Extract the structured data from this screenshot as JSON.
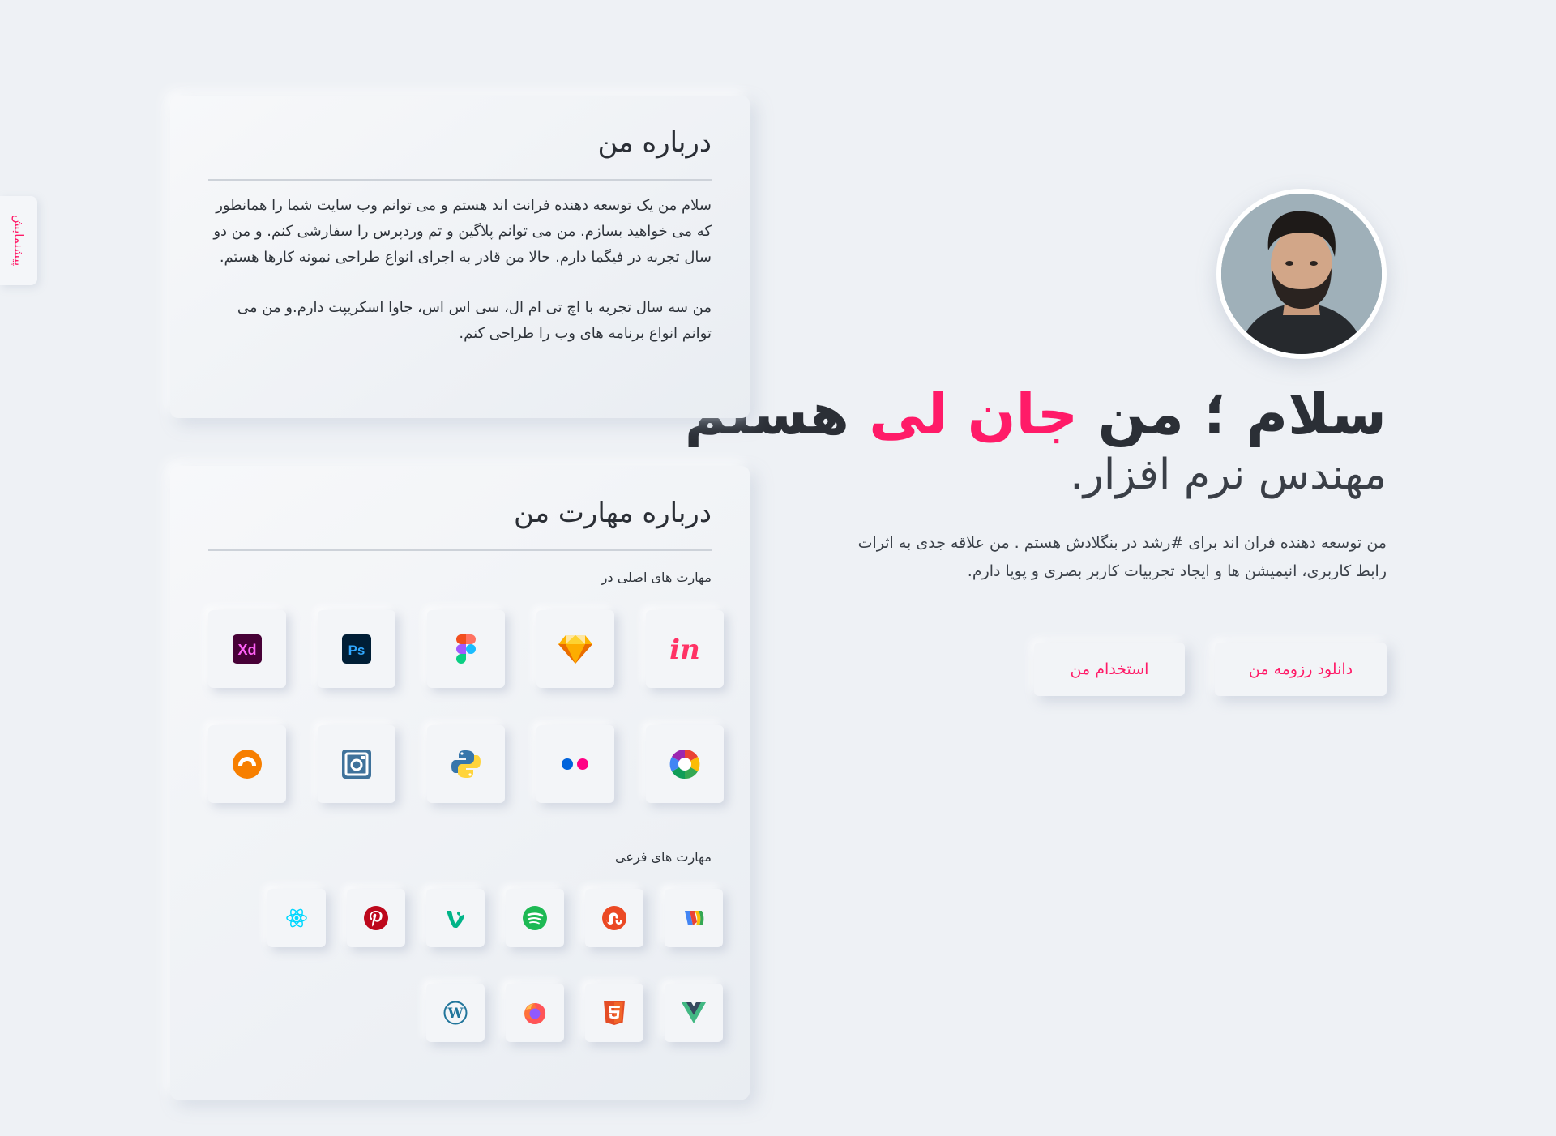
{
  "side_tab": {
    "label": "پیشنمایش"
  },
  "hero": {
    "title_before": "سلام ؛ من ",
    "title_accent": "جان لی",
    "title_after": " هستم",
    "subtitle": "مهندس نرم افزار.",
    "description": "من توسعه دهنده فران اند برای #رشد در بنگلادش هستم . من علاقه جدی به اثرات رابط کاربری، انیمیشن ها و ایجاد تجربیات کاربر بصری و پویا دارم.",
    "buttons": {
      "resume": "دانلود رزومه من",
      "hire": "استخدام من"
    },
    "accent_color": "#ff1b68"
  },
  "about": {
    "title": "درباره من",
    "paragraph_1": "سلام من یک توسعه دهنده فرانت اند هستم و می توانم وب سایت شما را همانطور که می خواهید بسازم. من می توانم پلاگین و تم وردپرس را سفارشی کنم. و من دو سال تجربه در فیگما دارم. حالا من قادر به اجرای انواع طراحی نمونه کارها هستم.",
    "paragraph_2": "من سه سال تجربه با اچ تی ام ال، سی اس اس، جاوا اسکریپت دارم.و من می توانم انواع برنامه های وب را طراحی کنم."
  },
  "skills": {
    "title": "درباره مهارت من",
    "main_label": "مهارت های اصلی در",
    "sub_label": "مهارت های فرعی",
    "main_icons": [
      "adobe-xd-icon",
      "photoshop-icon",
      "figma-icon",
      "sketch-icon",
      "invision-icon",
      "grooveshark-icon",
      "instagram-icon",
      "python-icon",
      "flickr-icon",
      "picasa-icon"
    ],
    "sub_icons_row1": [
      "react-icon",
      "pinterest-icon",
      "vine-icon",
      "spotify-icon",
      "stumbleupon-icon",
      "google-wallet-icon"
    ],
    "sub_icons_row2": [
      "wordpress-icon",
      "firefox-icon",
      "html5-icon",
      "vuejs-icon"
    ]
  }
}
